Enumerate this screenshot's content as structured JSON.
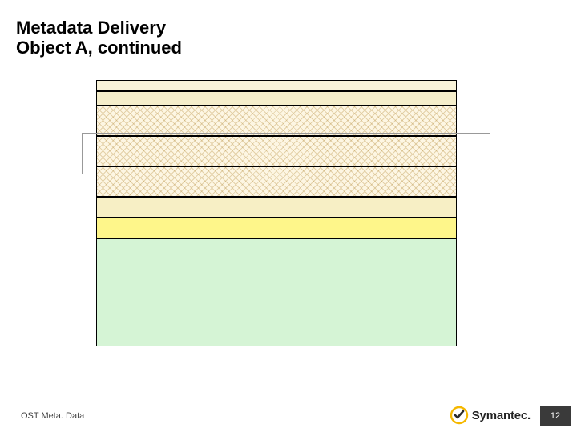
{
  "title": "Metadata Delivery\nObject A, continued",
  "footer": {
    "left_text": "OST Meta. Data",
    "brand": "Symantec.",
    "page_number": "12"
  },
  "diagram": {
    "layers": [
      {
        "name": "top-thin-1",
        "style": "solid-cream"
      },
      {
        "name": "top-thin-2",
        "style": "solid-cream"
      },
      {
        "name": "hatch-row-1",
        "style": "crosshatch"
      },
      {
        "name": "hatch-row-2",
        "style": "crosshatch"
      },
      {
        "name": "hatch-row-3",
        "style": "crosshatch"
      },
      {
        "name": "solid-row-1",
        "style": "solid-cream"
      },
      {
        "name": "solid-row-2",
        "style": "solid-yellow"
      },
      {
        "name": "bottom-block",
        "style": "solid-green"
      }
    ],
    "overlay_box": true
  },
  "colors": {
    "cream": "#f7efc5",
    "yellow": "#fef68a",
    "green": "#d5f4d5",
    "hatch_base": "#fdf6e3"
  }
}
